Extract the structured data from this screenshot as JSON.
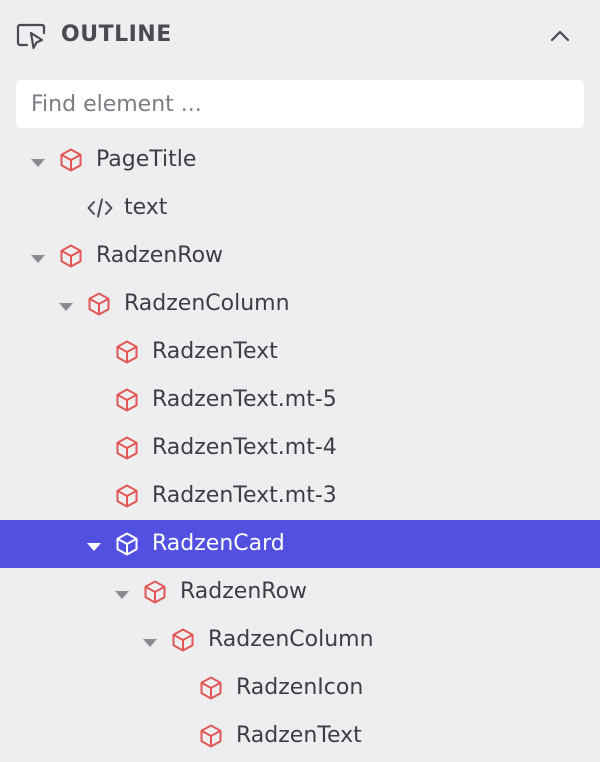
{
  "header": {
    "title": "OUTLINE",
    "icon": "outline-pointer-icon",
    "collapse_icon": "chevron-up-icon"
  },
  "search": {
    "placeholder": "Find element ...",
    "value": ""
  },
  "colors": {
    "selected_bg": "#5150e0",
    "component_icon": "#e05757",
    "panel_bg": "#eeeef0"
  },
  "tree": [
    {
      "label": "PageTitle",
      "depth": 0,
      "expanded": true,
      "has_children": true,
      "icon": "cube-icon",
      "selected": false
    },
    {
      "label": "text",
      "depth": 1,
      "expanded": false,
      "has_children": false,
      "icon": "code-icon",
      "selected": false
    },
    {
      "label": "RadzenRow",
      "depth": 0,
      "expanded": true,
      "has_children": true,
      "icon": "cube-icon",
      "selected": false
    },
    {
      "label": "RadzenColumn",
      "depth": 1,
      "expanded": true,
      "has_children": true,
      "icon": "cube-icon",
      "selected": false
    },
    {
      "label": "RadzenText",
      "depth": 2,
      "expanded": false,
      "has_children": false,
      "icon": "cube-icon",
      "selected": false
    },
    {
      "label": "RadzenText.mt-5",
      "depth": 2,
      "expanded": false,
      "has_children": false,
      "icon": "cube-icon",
      "selected": false
    },
    {
      "label": "RadzenText.mt-4",
      "depth": 2,
      "expanded": false,
      "has_children": false,
      "icon": "cube-icon",
      "selected": false
    },
    {
      "label": "RadzenText.mt-3",
      "depth": 2,
      "expanded": false,
      "has_children": false,
      "icon": "cube-icon",
      "selected": false
    },
    {
      "label": "RadzenCard",
      "depth": 2,
      "expanded": true,
      "has_children": true,
      "icon": "cube-icon",
      "selected": true
    },
    {
      "label": "RadzenRow",
      "depth": 3,
      "expanded": true,
      "has_children": true,
      "icon": "cube-icon",
      "selected": false
    },
    {
      "label": "RadzenColumn",
      "depth": 4,
      "expanded": true,
      "has_children": true,
      "icon": "cube-icon",
      "selected": false
    },
    {
      "label": "RadzenIcon",
      "depth": 5,
      "expanded": false,
      "has_children": false,
      "icon": "cube-icon",
      "selected": false
    },
    {
      "label": "RadzenText",
      "depth": 5,
      "expanded": false,
      "has_children": false,
      "icon": "cube-icon",
      "selected": false
    }
  ]
}
